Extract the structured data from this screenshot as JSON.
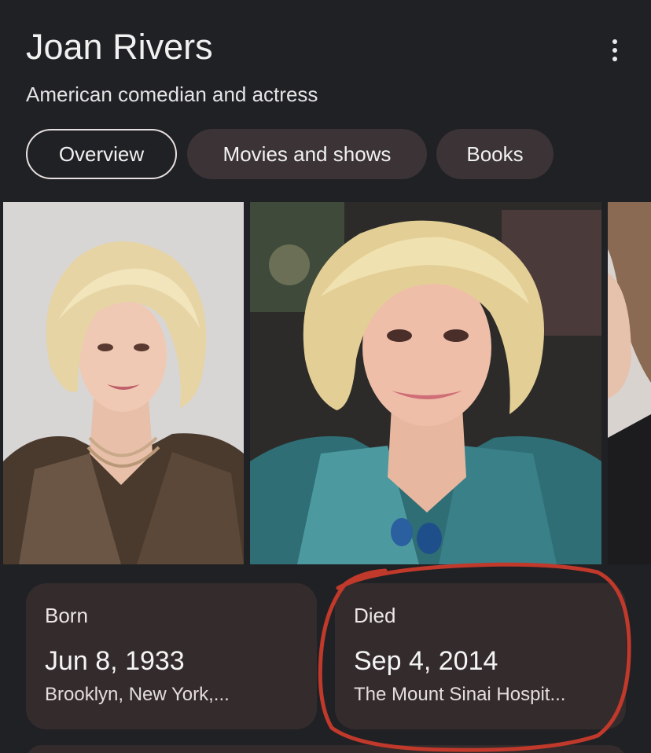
{
  "entity": {
    "name": "Joan Rivers",
    "description": "American comedian and actress"
  },
  "menu": {
    "icon": "more-vert-icon"
  },
  "tabs": [
    {
      "label": "Overview",
      "active": true
    },
    {
      "label": "Movies and shows",
      "active": false
    },
    {
      "label": "Books",
      "active": false
    }
  ],
  "photos": [
    {
      "icon": "portrait-photo"
    },
    {
      "icon": "portrait-photo"
    },
    {
      "icon": "portrait-photo-partial"
    }
  ],
  "facts": {
    "born": {
      "label": "Born",
      "date": "Jun 8, 1933",
      "place": "Brooklyn, New York,..."
    },
    "died": {
      "label": "Died",
      "date": "Sep 4, 2014",
      "place": "The Mount Sinai Hospit..."
    }
  },
  "colors": {
    "background": "#202124",
    "card": "#332b2c",
    "chip": "#3b3335",
    "annotation": "#c0392b"
  }
}
